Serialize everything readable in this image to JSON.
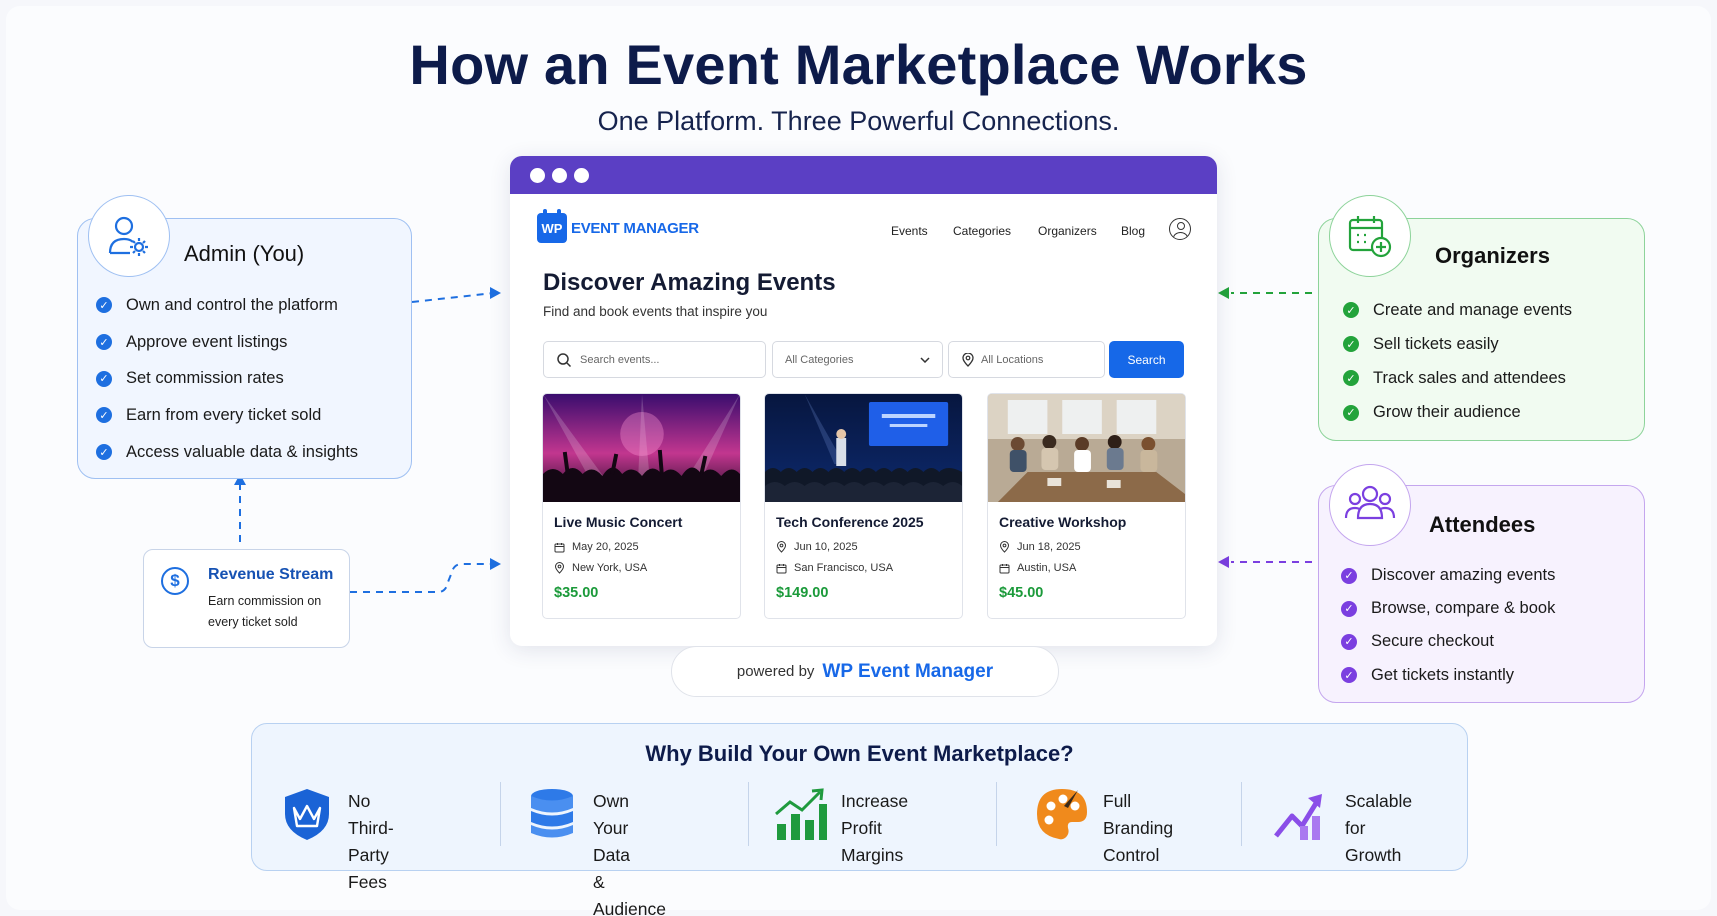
{
  "header": {
    "title": "How an Event Marketplace Works",
    "subtitle": "One Platform. Three Powerful Connections."
  },
  "admin": {
    "title": "Admin (You)",
    "items": [
      "Own and control the platform",
      "Approve event listings",
      "Set commission rates",
      "Earn from every ticket sold",
      "Access valuable data & insights"
    ],
    "accent": "#1e6fe0"
  },
  "revenue": {
    "title": "Revenue Stream",
    "description": "Earn commission on every ticket sold"
  },
  "organizers": {
    "title": "Organizers",
    "items": [
      "Create and manage events",
      "Sell tickets easily",
      "Track sales and attendees",
      "Grow their audience"
    ],
    "accent": "#23a33b"
  },
  "attendees": {
    "title": "Attendees",
    "items": [
      "Discover amazing events",
      "Browse, compare & book",
      "Secure checkout",
      "Get tickets instantly"
    ],
    "accent": "#7b3fe0"
  },
  "browser": {
    "brand_logo": "WP",
    "brand_name": "EVENT MANAGER",
    "nav": [
      "Events",
      "Categories",
      "Organizers",
      "Blog"
    ],
    "hero_title": "Discover Amazing Events",
    "hero_subtitle": "Find and book events that inspire you",
    "search_placeholder": "Search events...",
    "category_select": "All Categories",
    "location_select": "All Locations",
    "search_button": "Search",
    "events": [
      {
        "name": "Live Music Concert",
        "date": "May 20, 2025",
        "location": "New York, USA",
        "price": "$35.00"
      },
      {
        "name": "Tech Conference 2025",
        "date": "Jun 10, 2025",
        "location": "San Francisco, USA",
        "price": "$149.00"
      },
      {
        "name": "Creative Workshop",
        "date": "Jun 18, 2025",
        "location": "Austin, USA",
        "price": "$45.00"
      }
    ],
    "bar_color": "#5b3fc4"
  },
  "powered": {
    "prefix": "powered by",
    "brand": "WP Event Manager"
  },
  "why": {
    "title": "Why Build Your Own Event Marketplace?",
    "items": [
      {
        "label": "No Third-Party\nFees",
        "icon": "shield-crown-icon"
      },
      {
        "label": "Own Your Data\n& Audience",
        "icon": "database-icon"
      },
      {
        "label": "Increase Profit\nMargins",
        "icon": "growth-bars-icon"
      },
      {
        "label": "Full Branding\nControl",
        "icon": "palette-icon"
      },
      {
        "label": "Scalable for\nGrowth",
        "icon": "trend-up-icon"
      }
    ]
  }
}
